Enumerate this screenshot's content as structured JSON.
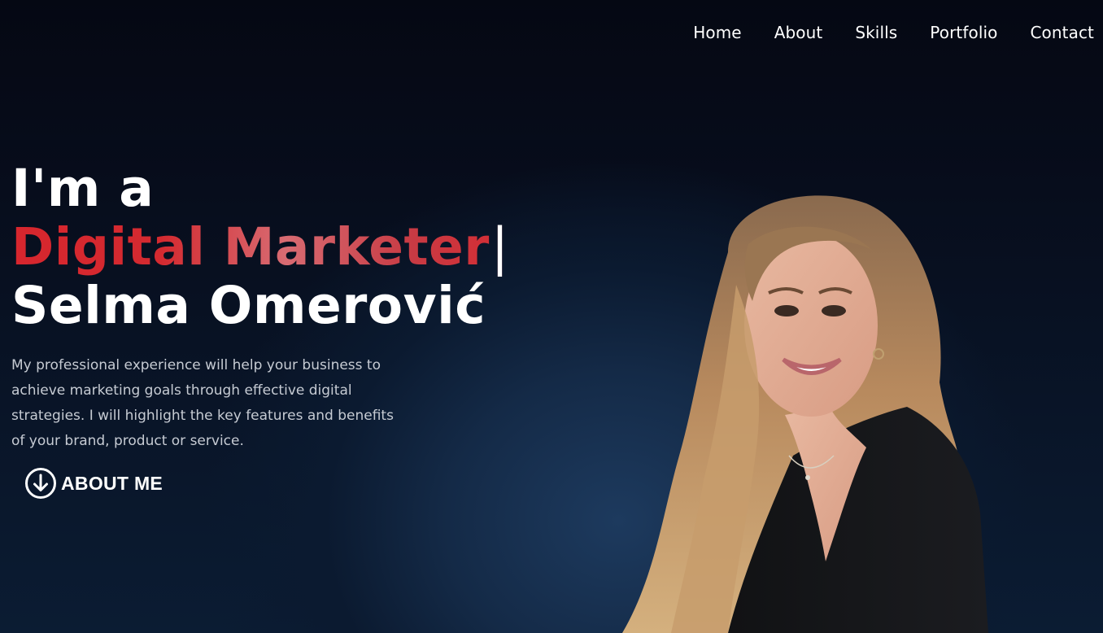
{
  "nav": {
    "items": [
      {
        "label": "Home"
      },
      {
        "label": "About"
      },
      {
        "label": "Skills"
      },
      {
        "label": "Portfolio"
      },
      {
        "label": "Contact"
      }
    ]
  },
  "hero": {
    "line1": "I'm a",
    "role": "Digital Marketer",
    "cursor": "|",
    "name": "Selma Omerović",
    "description": "My professional experience will help your business to achieve marketing goals through effective digital strategies. I will highlight the key features and benefits of your brand, product or service.",
    "cta_label": "ABOUT ME",
    "cta_icon": "arrow-down-circle-icon"
  },
  "colors": {
    "background": "#050814",
    "glow": "#1d3a5e",
    "accent_red": "#d7262e",
    "text": "#ffffff",
    "muted_text": "#c6cbd3"
  }
}
